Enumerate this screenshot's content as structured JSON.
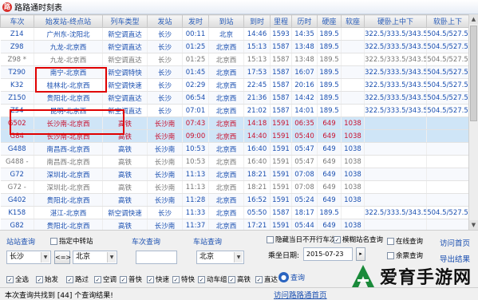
{
  "window": {
    "title": "路路通时刻表",
    "icon": "train-logo-icon"
  },
  "table": {
    "headers": [
      "车次",
      "始发站-终点站",
      "列车类型",
      "发站",
      "发时",
      "到站",
      "到时",
      "里程",
      "历时",
      "硬座",
      "软座",
      "硬卧上中下",
      "软卧上下"
    ],
    "rows": [
      [
        "Z14",
        "广州东-沈阳北",
        "新空调直达",
        "长沙",
        "00:11",
        "北京",
        "14:46",
        "1593",
        "14:35",
        "189.5",
        "",
        "322.5/333.5/343.5",
        "504.5/527.5"
      ],
      [
        "Z98",
        "九龙-北京西",
        "新空调直达",
        "长沙",
        "01:25",
        "北京西",
        "15:13",
        "1587",
        "13:48",
        "189.5",
        "",
        "322.5/333.5/343.5",
        "504.5/527.5"
      ],
      [
        "Z98 *",
        "九龙-北京西",
        "新空调直达",
        "长沙",
        "01:25",
        "北京西",
        "15:13",
        "1587",
        "13:48",
        "189.5",
        "",
        "322.5/333.5/343.5",
        "504.5/527.5"
      ],
      [
        "T290",
        "南宁-北京西",
        "新空调特快",
        "长沙",
        "01:45",
        "北京西",
        "17:53",
        "1587",
        "16:07",
        "189.5",
        "",
        "322.5/333.5/343.5",
        "504.5/527.5"
      ],
      [
        "K32",
        "桂林北-北京西",
        "新空调快速",
        "长沙",
        "02:29",
        "北京西",
        "22:45",
        "1587",
        "20:16",
        "189.5",
        "",
        "322.5/333.5/343.5",
        "504.5/527.5"
      ],
      [
        "Z150",
        "贵阳北-北京西",
        "新空调直达",
        "长沙",
        "06:54",
        "北京西",
        "21:36",
        "1587",
        "14:42",
        "189.5",
        "",
        "322.5/333.5/343.5",
        "504.5/527.5"
      ],
      [
        "Z54",
        "昆明-北京西",
        "新空调直达",
        "长沙",
        "07:01",
        "北京西",
        "21:02",
        "1587",
        "14:01",
        "189.5",
        "",
        "322.5/333.5/343.5",
        "504.5/527.5"
      ],
      [
        "G502",
        "长沙南-北京西",
        "高铁",
        "长沙南",
        "07:43",
        "北京西",
        "14:18",
        "1591",
        "06:35",
        "649",
        "1038",
        "",
        ""
      ],
      [
        "G84",
        "长沙南-北京西",
        "高铁",
        "长沙南",
        "09:00",
        "北京西",
        "14:40",
        "1591",
        "05:40",
        "649",
        "1038",
        "",
        ""
      ],
      [
        "G488",
        "南昌西-北京西",
        "高铁",
        "长沙南",
        "10:53",
        "北京西",
        "16:40",
        "1591",
        "05:47",
        "649",
        "1038",
        "",
        ""
      ],
      [
        "G488 -",
        "南昌西-北京西",
        "高铁",
        "长沙南",
        "10:53",
        "北京西",
        "16:40",
        "1591",
        "05:47",
        "649",
        "1038",
        "",
        ""
      ],
      [
        "G72",
        "深圳北-北京西",
        "高铁",
        "长沙南",
        "11:13",
        "北京西",
        "18:21",
        "1591",
        "07:08",
        "649",
        "1038",
        "",
        ""
      ],
      [
        "G72 -",
        "深圳北-北京西",
        "高铁",
        "长沙南",
        "11:13",
        "北京西",
        "18:21",
        "1591",
        "07:08",
        "649",
        "1038",
        "",
        ""
      ],
      [
        "G402",
        "贵阳北-北京西",
        "高铁",
        "长沙南",
        "11:28",
        "北京西",
        "16:52",
        "1591",
        "05:24",
        "649",
        "1038",
        "",
        ""
      ],
      [
        "K158",
        "湛江-北京西",
        "新空调快速",
        "长沙",
        "11:33",
        "北京西",
        "05:50",
        "1587",
        "18:17",
        "189.5",
        "",
        "322.5/333.5/343.5",
        "504.5/527.5"
      ],
      [
        "G82",
        "贵阳北-北京西",
        "高铁",
        "长沙南",
        "11:37",
        "北京西",
        "17:21",
        "1591",
        "05:44",
        "649",
        "1038",
        "",
        ""
      ],
      [
        "G66",
        "广州南-北京西",
        "高铁",
        "长沙南",
        "11:53",
        "北京西",
        "17:13",
        "1591",
        "05:20",
        "649",
        "1038",
        "",
        ""
      ]
    ]
  },
  "query": {
    "station_label": "站站查询",
    "transfer_label": "指定中转站",
    "from_value": "长沙",
    "swap_label": "<=>",
    "to_value": "北京",
    "train_label": "车次查询",
    "train_value": "",
    "station_query_label": "车站查询",
    "station_value": "北京",
    "hide_label": "隐藏当日不开行车次",
    "fuzzy_label": "模糊站名查询",
    "online_label": "在线查询",
    "remain_label": "余票查询",
    "date_label": "乘坐日期:",
    "date_value": "2015-07-23",
    "query_button": "查询",
    "home_link": "访问首页",
    "export_link": "导出结果",
    "homepage_link": "访问路路通首页"
  },
  "filters": [
    "全选",
    "始发",
    "路过",
    "空调",
    "普快",
    "快速",
    "特快",
    "动车组",
    "高铁",
    "直达"
  ],
  "status": {
    "text": "本次查询共找到 [44] 个查询结果!"
  },
  "watermark": {
    "text": "爱育手游网"
  }
}
